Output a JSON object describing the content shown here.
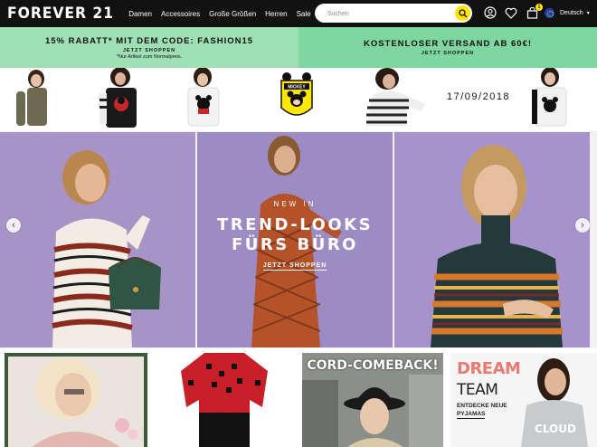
{
  "header": {
    "logo": "FOREVER 21",
    "nav": [
      "Damen",
      "Accessoires",
      "Große Größen",
      "Herren",
      "Sale"
    ],
    "search_placeholder": "Suchen",
    "cart_count": "1",
    "language": "Deutsch"
  },
  "promos": [
    {
      "headline": "15% RABATT* MIT DEM CODE: FASHION15",
      "link": "JETZT SHOPPEN",
      "note": "*Nur Artikel zum Normalpreis."
    },
    {
      "headline": "KOSTENLOSER VERSAND AB 60€!",
      "link": "JETZT SHOPPEN"
    }
  ],
  "disney_strip": {
    "badge_icon": "mickey-badge-icon",
    "badge_text": "MICKEY",
    "date": "17/09/2018"
  },
  "hero": {
    "kicker": "NEW IN",
    "title_line1": "TREND-LOOKS",
    "title_line2": "FÜRS BÜRO",
    "link": "JETZT SHOPPEN"
  },
  "tiles": {
    "cord_title": "CORD-COMEBACK!",
    "dream_line1": "DREAM",
    "dream_line2": "TEAM",
    "dream_sub1": "ENTDECKE NEUE",
    "dream_sub2": "PYJAMAS"
  },
  "colors": {
    "topbar": "#111111",
    "accent_yellow": "#ffe600",
    "promo_green": "#9ee0b4",
    "hero_purple": "#a08cc8"
  }
}
